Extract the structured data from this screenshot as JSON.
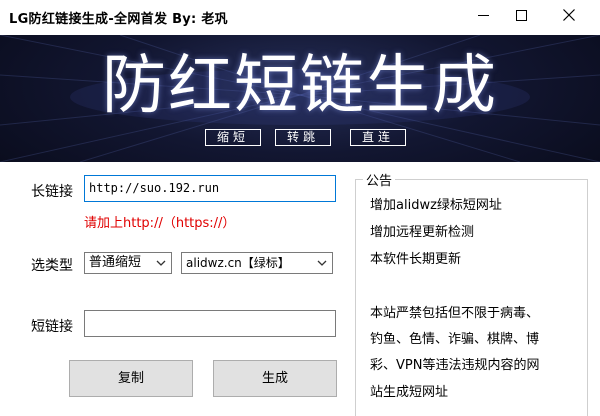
{
  "window": {
    "title": "LG防红链接生成-全网首发  By: 老巩"
  },
  "banner": {
    "title": "防红短链生成",
    "buttons": [
      "缩短",
      "转跳",
      "直连"
    ]
  },
  "form": {
    "long_link_label": "长链接",
    "long_link_value": "http://suo.192.run",
    "hint": "请加上http://（https://）",
    "type_label": "选类型",
    "type_selected": "普通缩短",
    "domain_selected": "alidwz.cn【绿标】",
    "short_link_label": "短链接",
    "short_link_value": "",
    "copy_button": "复制",
    "generate_button": "生成"
  },
  "notice": {
    "title": "公告",
    "lines": [
      "增加alidwz绿标短网址",
      "增加远程更新检测",
      "本软件长期更新",
      "",
      "本站严禁包括但不限于病毒、",
      "钓鱼、色情、诈骗、棋牌、博",
      "彩、VPN等违法违规内容的网",
      "站生成短网址"
    ]
  },
  "icons": {
    "minimize": "minimize-icon",
    "maximize": "maximize-icon",
    "close": "close-icon",
    "dropdown": "chevron-down-icon"
  }
}
